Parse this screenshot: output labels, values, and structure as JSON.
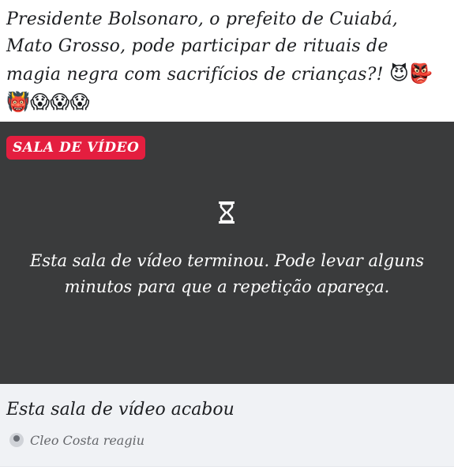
{
  "post": {
    "text_line1": "Presidente Bolsonaro, o prefeito de Cuiabá,",
    "text_line2": "Mato Grosso, pode participar de rituais de",
    "text_line3": "magia negra com sacrifícios de crianças?!",
    "emoji_line3": "😈👺",
    "emoji_line4": "👹😱😱😱"
  },
  "video_room": {
    "badge_label": "SALA DE VÍDEO",
    "message_line1": "Esta sala de vídeo terminou. Pode levar alguns",
    "message_line2": "minutos para que a repetição apareça.",
    "icon": "hourglass-icon"
  },
  "footer": {
    "title": "Esta sala de vídeo acabou",
    "reaction_text": "Cleo Costa reagiu"
  },
  "colors": {
    "badge_bg": "#e41e3f",
    "video_bg": "#3a3b3c",
    "footer_bg": "#f0f2f5"
  }
}
